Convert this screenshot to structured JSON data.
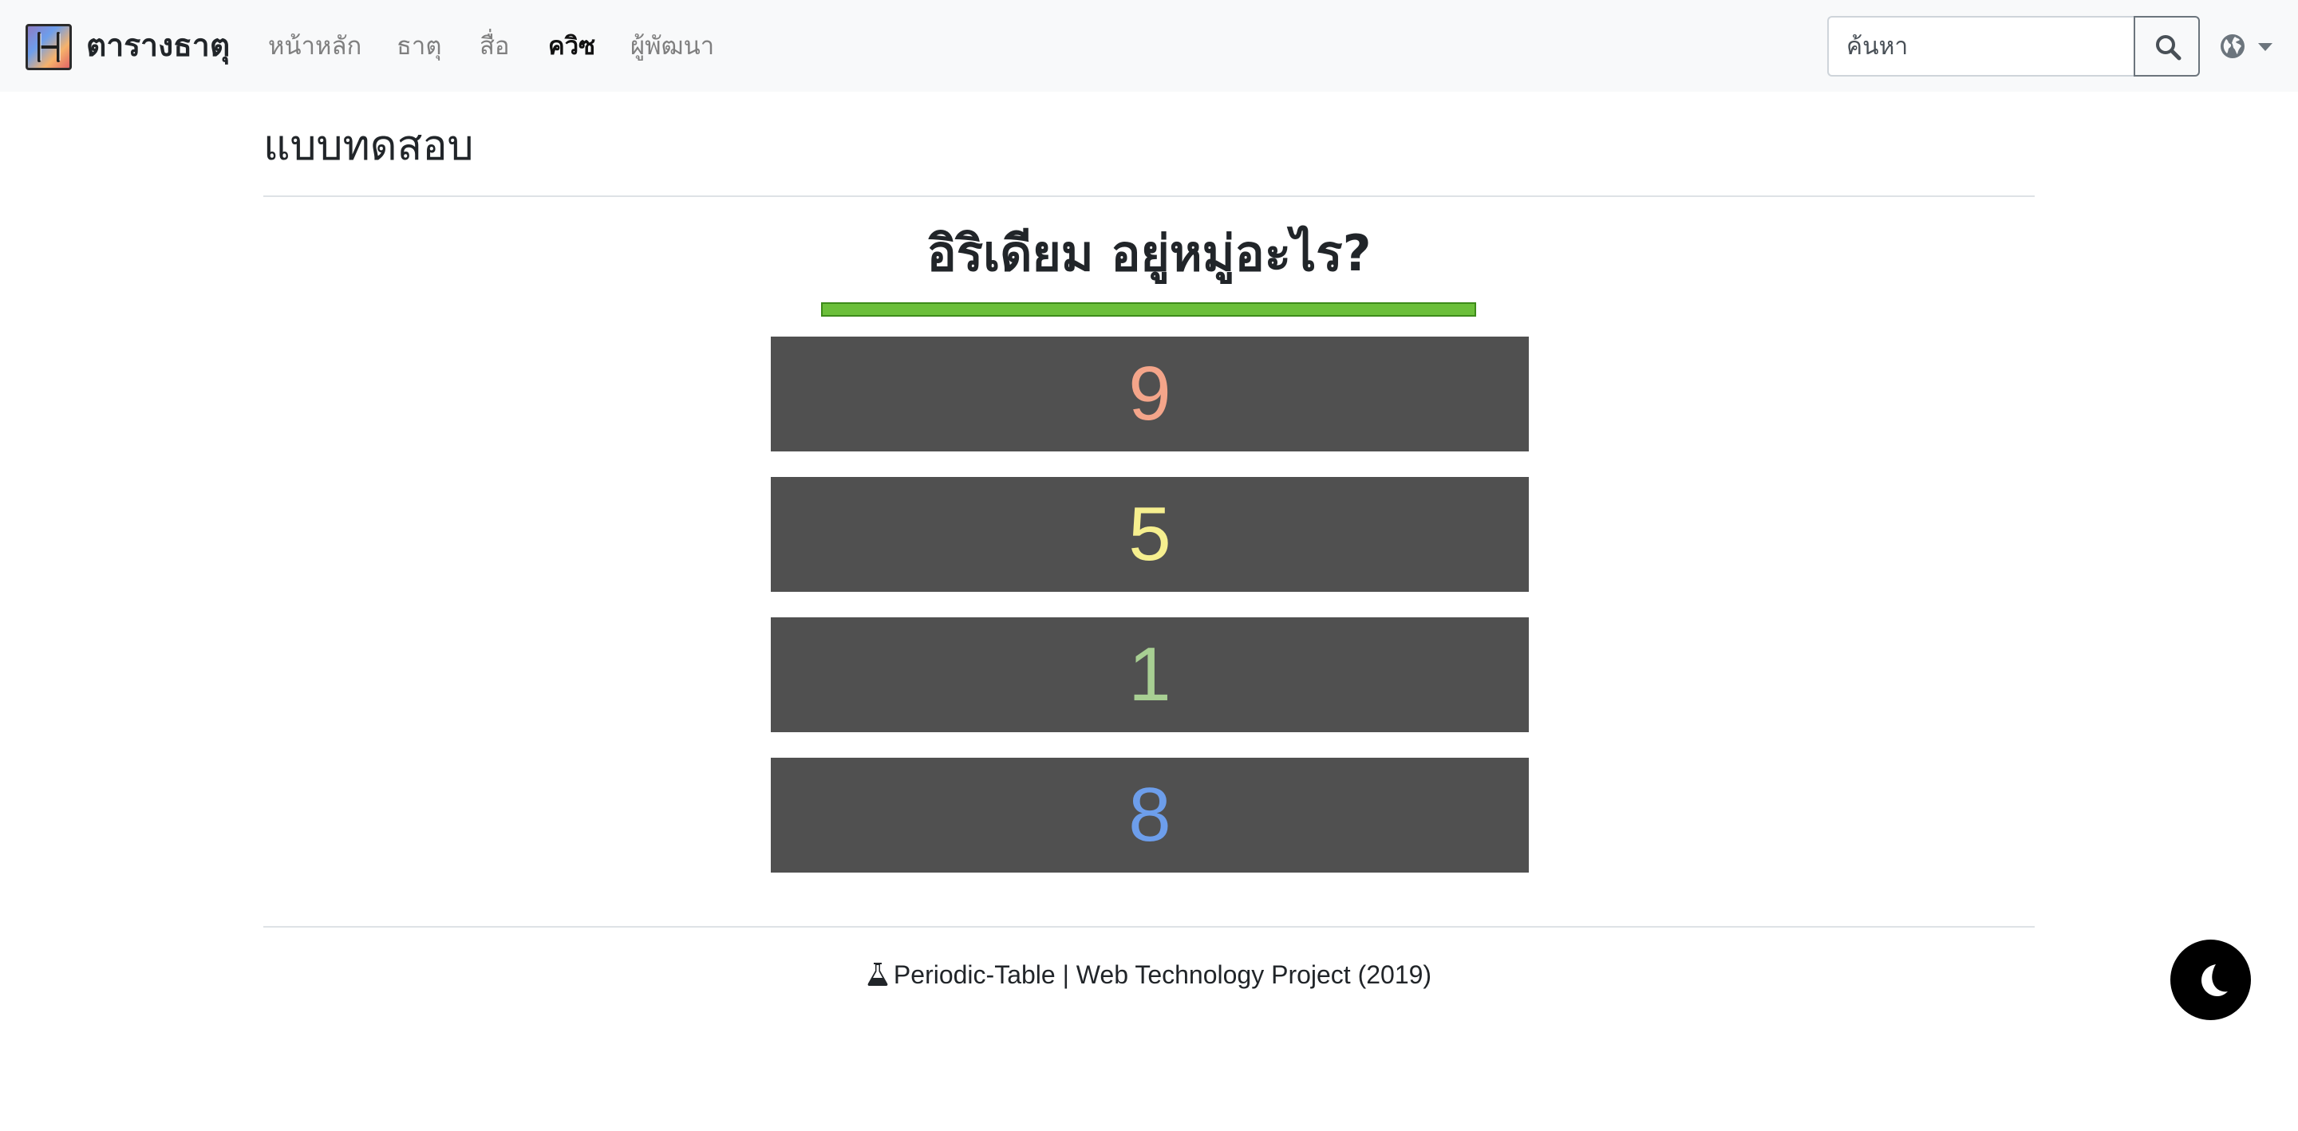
{
  "navbar": {
    "brand_letter": "H",
    "brand_name": "ตารางธาตุ",
    "links": [
      {
        "label": "หน้าหลัก",
        "active": false
      },
      {
        "label": "ธาตุ",
        "active": false
      },
      {
        "label": "สื่อ",
        "active": false
      },
      {
        "label": "ควิซ",
        "active": true
      },
      {
        "label": "ผู้พัฒนา",
        "active": false
      }
    ],
    "search": {
      "placeholder": "ค้นหา",
      "value": ""
    },
    "icons": {
      "search": "search-icon",
      "language": "globe-icon",
      "dropdown": "caret-down-icon"
    }
  },
  "main": {
    "page_title": "แบบทดสอบ",
    "question": "อิริเดียม อยู่หมู่อะไร?",
    "timer_fraction": 1.0,
    "timer_color": "#6bbf3a",
    "answers": [
      {
        "label": "9",
        "color": "#f4a58a"
      },
      {
        "label": "5",
        "color": "#f6ef8f"
      },
      {
        "label": "1",
        "color": "#a8cf93"
      },
      {
        "label": "8",
        "color": "#6d9eeb"
      }
    ],
    "answer_background": "#505050"
  },
  "footer": {
    "icon": "flask-icon",
    "text": "Periodic-Table | Web Technology Project (2019)"
  },
  "dark_mode_toggle": {
    "icon": "moon-icon"
  }
}
